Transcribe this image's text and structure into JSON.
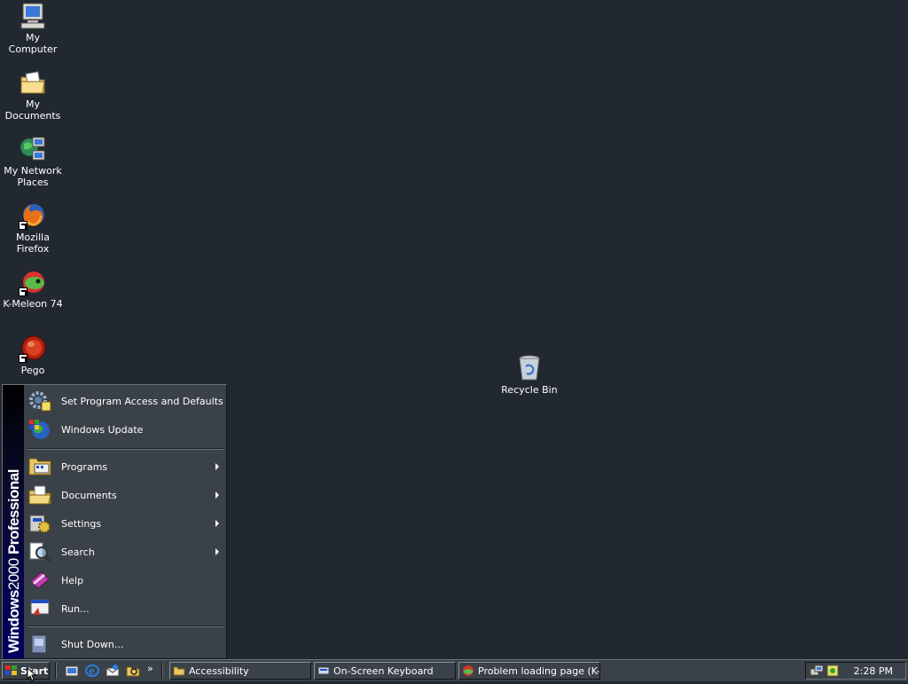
{
  "desktop": {
    "icons": [
      {
        "label": "My Computer",
        "icon": "computer-icon"
      },
      {
        "label": "My Documents",
        "icon": "documents-folder-icon"
      },
      {
        "label": "My Network Places",
        "icon": "network-icon"
      },
      {
        "label": "Mozilla Firefox",
        "icon": "firefox-icon"
      },
      {
        "label": "K-Meleon 74",
        "icon": "k-meleon-icon"
      },
      {
        "label": "Pego",
        "icon": "pego-icon"
      },
      {
        "label": "Recycle Bin",
        "icon": "recycle-bin-icon"
      }
    ]
  },
  "start_menu": {
    "banner_bold": "Windows",
    "banner_thin": "2000",
    "banner_edition": "Professional",
    "items": [
      {
        "label": "Set Program Access and Defaults",
        "icon": "program-access-icon",
        "submenu": false
      },
      {
        "label": "Windows Update",
        "icon": "windows-update-icon",
        "submenu": false
      },
      {
        "label": "Programs",
        "icon": "programs-icon",
        "submenu": true
      },
      {
        "label": "Documents",
        "icon": "documents-icon",
        "submenu": true
      },
      {
        "label": "Settings",
        "icon": "settings-icon",
        "submenu": true
      },
      {
        "label": "Search",
        "icon": "search-icon",
        "submenu": true
      },
      {
        "label": "Help",
        "icon": "help-icon",
        "submenu": false
      },
      {
        "label": "Run...",
        "icon": "run-icon",
        "submenu": false
      },
      {
        "label": "Shut Down...",
        "icon": "shutdown-icon",
        "submenu": false
      }
    ]
  },
  "taskbar": {
    "start_label": "Start",
    "quick_launch_more": "»",
    "tasks": [
      {
        "label": "Accessibility",
        "icon": "folder-icon"
      },
      {
        "label": "On-Screen Keyboard",
        "icon": "keyboard-icon"
      },
      {
        "label": "Problem loading page (K-...",
        "icon": "k-meleon-icon"
      }
    ],
    "clock": "2:28 PM"
  },
  "colors": {
    "desktop": "#212830",
    "menu": "#3a4148",
    "banner": "#000060"
  }
}
